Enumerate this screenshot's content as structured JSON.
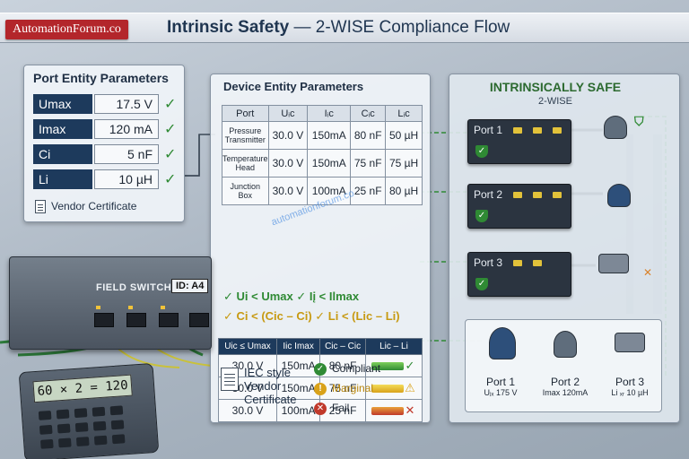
{
  "header": {
    "brand": "AutomationForum.co",
    "title_bold": "Intrinsic Safety",
    "title_rest": " — 2-WISE Compliance Flow"
  },
  "port_entity": {
    "title": "Port Entity Parameters",
    "rows": [
      {
        "key": "Umax",
        "value": "17.5 V"
      },
      {
        "key": "Imax",
        "value": "120 mA"
      },
      {
        "key": "Ci",
        "value": "5 nF"
      },
      {
        "key": "Li",
        "value": "10 µH"
      }
    ],
    "certificate": "Vendor Certificate"
  },
  "device_entity": {
    "title": "Device Entity Parameters",
    "headers": [
      "Port",
      "Uᵢc",
      "Iᵢc",
      "Cᵢc",
      "Lᵢc"
    ],
    "rows": [
      {
        "port": "Pressure Transmitter",
        "u": "30.0 V",
        "i": "150mA",
        "c": "80 nF",
        "l": "50 µH"
      },
      {
        "port": "Temperature Head",
        "u": "30.0 V",
        "i": "150mA",
        "c": "75 nF",
        "l": "75 µH"
      },
      {
        "port": "Junction Box",
        "u": "30.0 V",
        "i": "100mA",
        "c": "25 nF",
        "l": "80 µH"
      }
    ],
    "conditions": [
      "✓ Ui < Umax ✓ Iį < Ilmax",
      "✓ Ci < (Cic – Ci) ✓ Li < (Lic – Li)"
    ],
    "calc_headers": [
      "Uic ≤ Umax",
      "Iic Imax",
      "Cic – Cic",
      "Lic – Li"
    ],
    "calc_rows": [
      {
        "u": "30.0 V",
        "i": "150mA",
        "c": "80 nF",
        "status": "compliant"
      },
      {
        "u": "30.0 V",
        "i": "150mA",
        "c": "75 nF",
        "status": "marginal"
      },
      {
        "u": "30.0 V",
        "i": "100mA",
        "c": "25 nF",
        "status": "fail"
      }
    ]
  },
  "iec": {
    "line1": "IEC style",
    "line2": "Vendor",
    "line3": "Certificate"
  },
  "legend": {
    "compliant": "Compliant",
    "marginal": "Marginal",
    "fail": "Fail"
  },
  "safe_panel": {
    "title": "INTRINSICALLY SAFE",
    "subtitle": "2-WISE",
    "ports": [
      "Port 1",
      "Port 2",
      "Port 3"
    ],
    "field": [
      {
        "name": "Port 1",
        "detail": "Uⱼₓ 175 V"
      },
      {
        "name": "Port 2",
        "detail": "Imax 120mA"
      },
      {
        "name": "Port 3",
        "detail": "Li ₓᵣ 10 µH"
      }
    ]
  },
  "switch": {
    "name": "FIELD SWITCH",
    "id": "ID: A4"
  },
  "calculator": {
    "display": "60 × 2 = 120"
  },
  "watermark": "automationforum.co",
  "colors": {
    "compliant": "#2f8a34",
    "marginal": "#d9a21a",
    "fail": "#c0392b",
    "brand": "#b3262b"
  }
}
